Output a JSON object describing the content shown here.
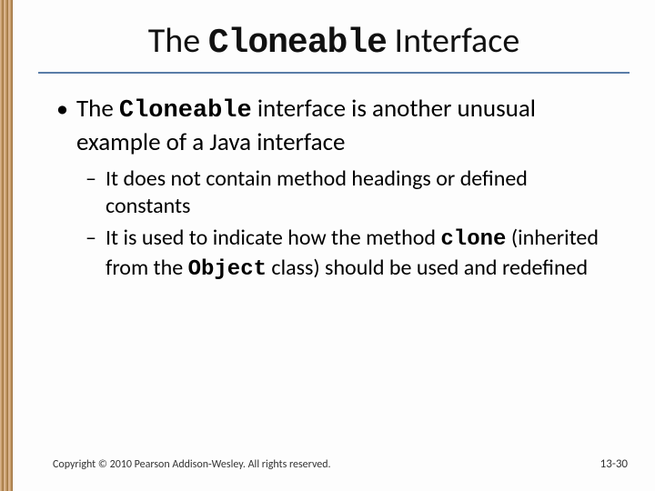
{
  "title": {
    "t1": "The ",
    "mono": "Cloneable",
    "t2": " Interface"
  },
  "bullet1": {
    "t1": "The ",
    "mono": "Cloneable",
    "t2": " interface is another unusual example of a Java interface"
  },
  "sub1": "It does not contain method headings or defined constants",
  "sub2": {
    "t1": "It is used to indicate how the method ",
    "mono1": "clone",
    "t2": " (inherited from the ",
    "mono2": "Object",
    "t3": " class) should be used and redefined"
  },
  "footer": "Copyright © 2010 Pearson Addison-Wesley. All rights reserved.",
  "pagenum": "13-30"
}
